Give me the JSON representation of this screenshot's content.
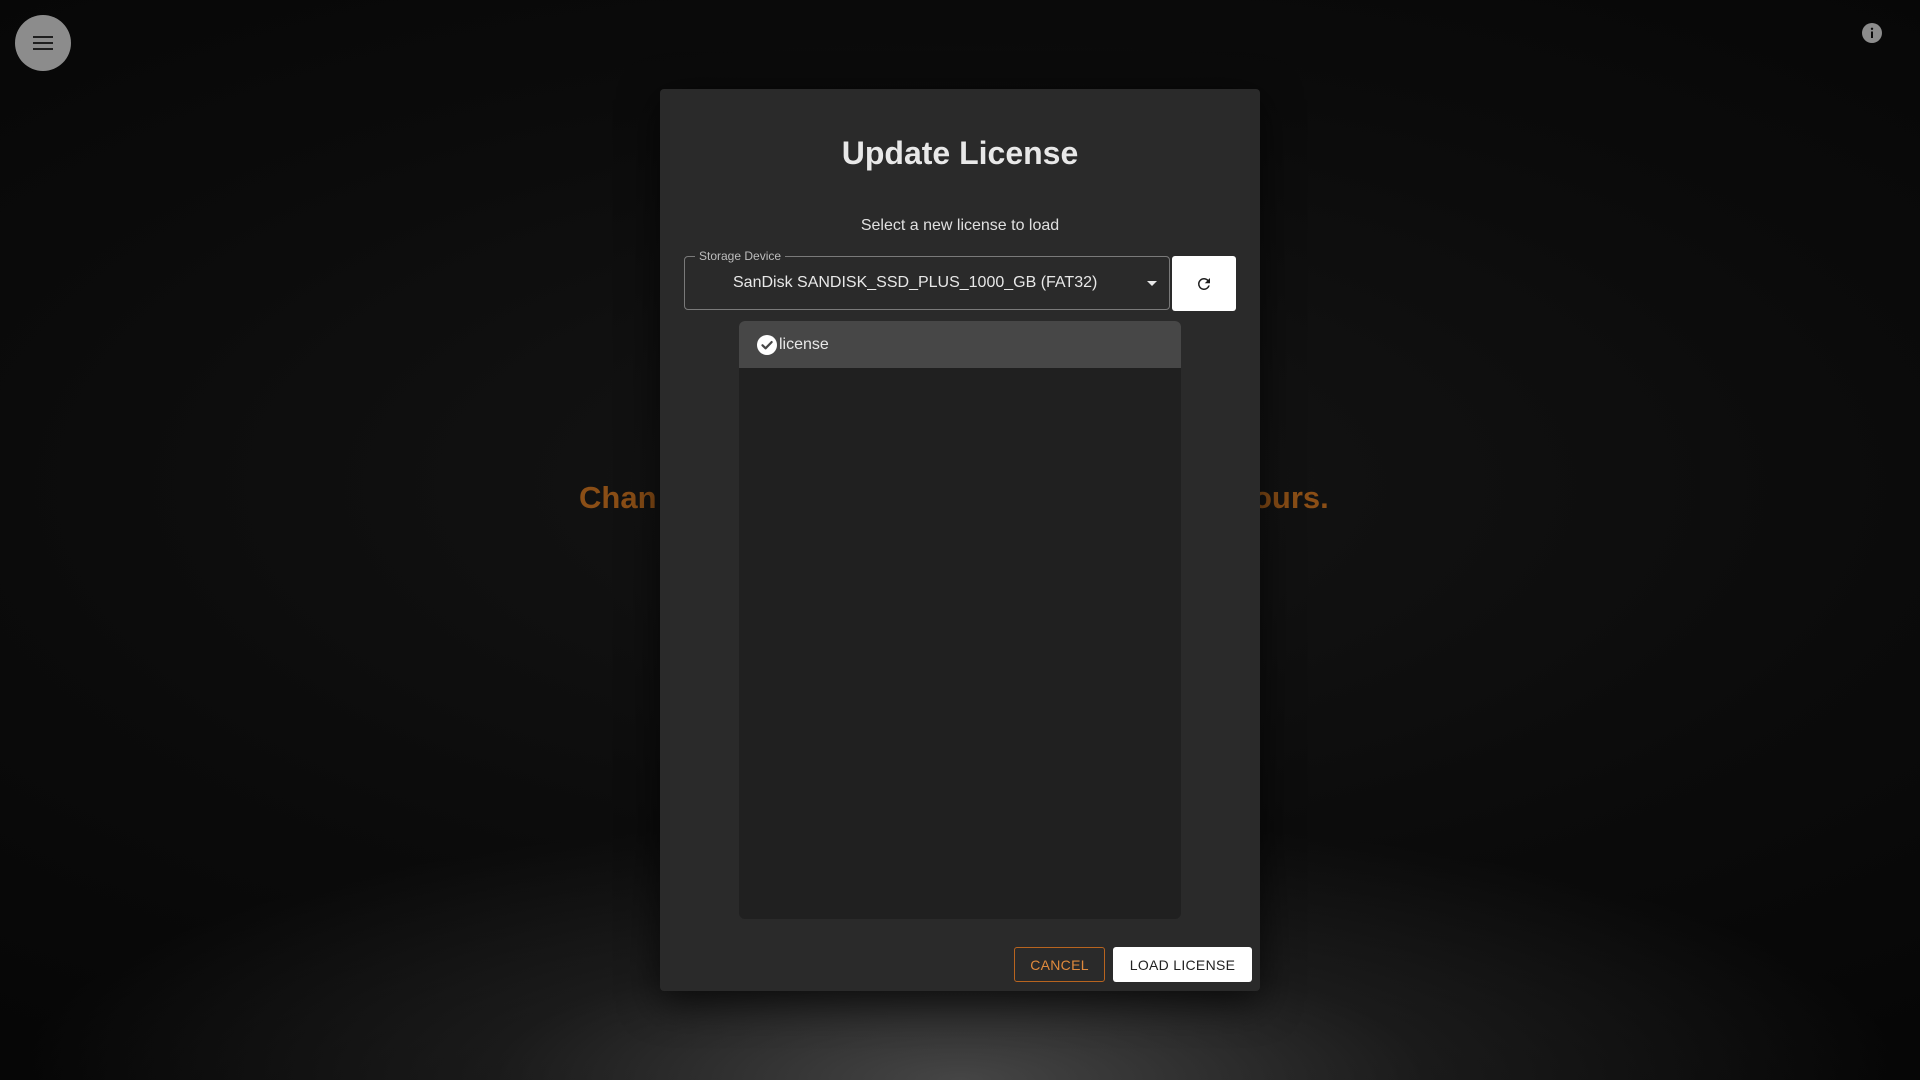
{
  "menu": {
    "icon": "hamburger-menu-icon"
  },
  "info": {
    "icon": "info-icon"
  },
  "backdrop": {
    "tagline_left": "Chan",
    "tagline_right": "ours."
  },
  "dialog": {
    "title": "Update License",
    "subtitle": "Select a new license to load",
    "storage_device": {
      "label": "Storage Device",
      "value": "SanDisk SANDISK_SSD_PLUS_1000_GB (FAT32)",
      "icon": "dropdown-arrow-icon"
    },
    "refresh": {
      "icon": "refresh-icon"
    },
    "files": [
      {
        "name": "license",
        "selected": true,
        "icon": "check-circle-icon"
      }
    ],
    "cancel_label": "CANCEL",
    "load_label": "LOAD LICENSE"
  },
  "colors": {
    "accent": "#e08a3c",
    "backdrop_text": "#8a4e16",
    "dialog_bg": "#2a2a2a",
    "list_bg": "#202020",
    "selected_item_bg": "#474747"
  }
}
